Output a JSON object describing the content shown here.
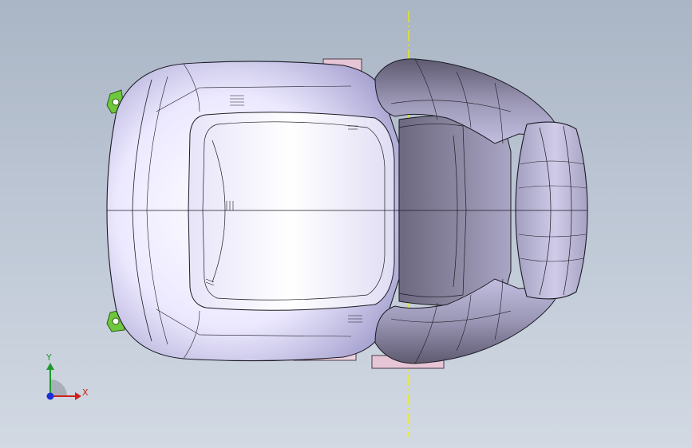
{
  "viewport": {
    "background_top": "#aab5c5",
    "background_bottom": "#d2d9e3",
    "model": "car-seat-top-view"
  },
  "triad": {
    "x_label": "X",
    "y_label": "Y",
    "x_color": "#d0201c",
    "y_color": "#1c9a2c",
    "z_color": "#1a2fd6"
  },
  "colors": {
    "seat_light": "#f6f4ff",
    "seat_mid": "#c8c4ea",
    "seat_dark": "#7a7690",
    "mount_green": "#6ec83c",
    "bracket_pink": "#e6c6d6",
    "center_line": "#f2f200"
  }
}
